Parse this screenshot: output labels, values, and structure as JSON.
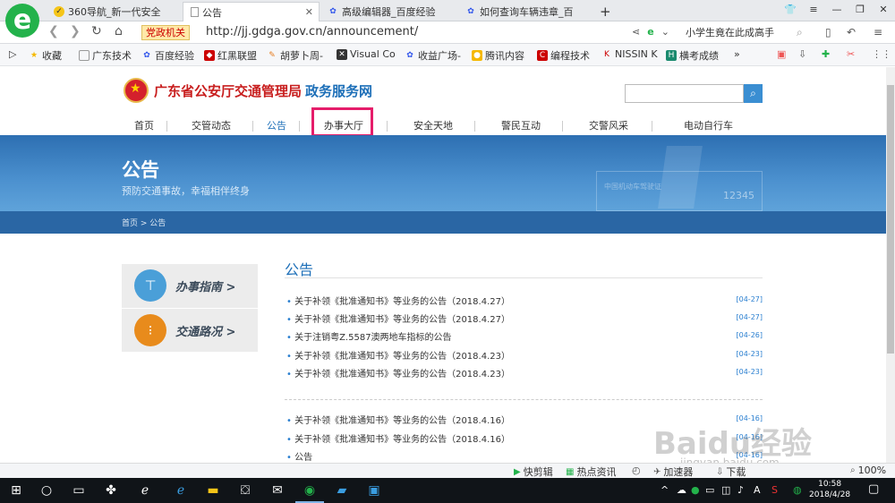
{
  "browser": {
    "tabs": [
      {
        "label": "360导航_新一代安全"
      },
      {
        "label": "公告"
      },
      {
        "label": "高级编辑器_百度经验"
      },
      {
        "label": "如何查询车辆违章_百"
      }
    ],
    "badge": "党政机关",
    "url": "http://jj.gdga.gov.cn/announcement/",
    "search_text": "小学生竟在此成高手",
    "bookmarks": [
      "收藏",
      "广东技术",
      "百度经验",
      "红黑联盟",
      "胡萝卜周-",
      "Visual Co",
      "收益广场-",
      "腾讯内容",
      "编程技术",
      "NISSIN K",
      "横考成绩"
    ],
    "status_items": [
      "快剪辑",
      "热点资讯",
      "加速器",
      "下载",
      "100%"
    ]
  },
  "site": {
    "org": "广东省公安厅交通管理局",
    "portal": "政务服务网",
    "nav": [
      "首页",
      "交管动态",
      "公告",
      "办事大厅",
      "安全天地",
      "警民互动",
      "交警风采",
      "电动自行车"
    ],
    "banner_title": "公告",
    "banner_subtitle": "预防交通事故，幸福相伴终身",
    "banner_deco_text": "中国机动车驾驶证",
    "banner_deco_num": "12345",
    "breadcrumb": "首页 > 公告"
  },
  "sidebar": [
    {
      "label": "办事指南 >",
      "icon": "signpost-icon",
      "color": "#4a9fd8"
    },
    {
      "label": "交通路况 >",
      "icon": "traffic-light-icon",
      "color": "#e88b1c"
    }
  ],
  "content": {
    "title": "公告",
    "items": [
      {
        "title": "关于补领《批准通知书》等业务的公告（2018.4.27）",
        "date": "[04-27]"
      },
      {
        "title": "关于补领《批准通知书》等业务的公告（2018.4.27）",
        "date": "[04-27]"
      },
      {
        "title": "关于注销粤Z.5587澳两地车指标的公告",
        "date": "[04-26]"
      },
      {
        "title": "关于补领《批准通知书》等业务的公告（2018.4.23）",
        "date": "[04-23]"
      },
      {
        "title": "关于补领《批准通知书》等业务的公告（2018.4.23）",
        "date": "[04-23]"
      }
    ],
    "items2": [
      {
        "title": "关于补领《批准通知书》等业务的公告（2018.4.16）",
        "date": "[04-16]"
      },
      {
        "title": "关于补领《批准通知书》等业务的公告（2018.4.16）",
        "date": "[04-16]"
      },
      {
        "title": "公告",
        "date": "[04-16]"
      }
    ]
  },
  "taskbar": {
    "time": "10:58",
    "date": "2018/4/28",
    "ime": "A"
  },
  "watermark": "Baidu经验",
  "watermark_url": "jingyan.baidu.com"
}
